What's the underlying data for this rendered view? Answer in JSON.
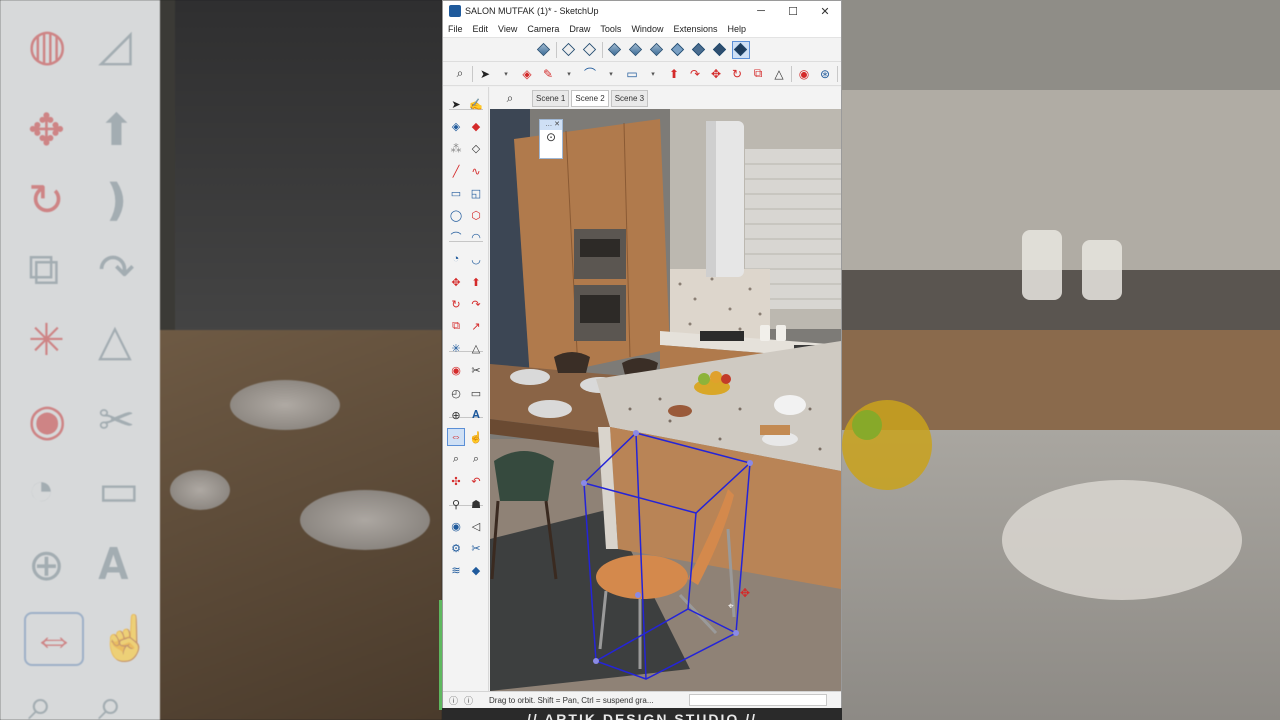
{
  "window": {
    "title": "SALON MUTFAK (1)* - SketchUp",
    "controls": {
      "minimize": "─",
      "maximize": "☐",
      "close": "✕"
    }
  },
  "menu": [
    "File",
    "Edit",
    "View",
    "Camera",
    "Draw",
    "Tools",
    "Window",
    "Extensions",
    "Help"
  ],
  "scene_bar": {
    "search_icon": "⌕",
    "tabs": [
      "Scene 1",
      "Scene 2",
      "Scene 3"
    ],
    "selected": "Scene 2"
  },
  "floating_panel": {
    "header": "… ✕",
    "icon": "⊙"
  },
  "status_bar": {
    "icons": [
      "ⓘ",
      "ⓘ"
    ],
    "message": "Drag to orbit. Shift = Pan, Ctrl = suspend gra..."
  },
  "footer_brand": "// ARTIK DESIGN STUDIO //",
  "colors": {
    "accent_active": "#cfe0f5",
    "selection_box": "#2424d8",
    "tool_red": "#d42a2a",
    "tool_blue": "#1f5a9c"
  },
  "icons": {
    "toolbar1": [
      "iso-view-icon",
      "top-view-icon",
      "front-view-icon",
      "right-view-icon",
      "back-view-icon",
      "left-view-icon",
      "xray-icon",
      "wireframe-icon",
      "shaded-icon",
      "textured-icon"
    ],
    "toolbar2": [
      "zoom-icon",
      "select-icon",
      "eraser-icon",
      "pencil-icon",
      "arc-icon",
      "rectangle-icon",
      "pushpull-icon",
      "followme-icon",
      "move-icon",
      "rotate-icon",
      "scale-icon",
      "tape-icon",
      "protractor-icon",
      "paint-icon",
      "walk-icon",
      "orbit-icon"
    ]
  }
}
